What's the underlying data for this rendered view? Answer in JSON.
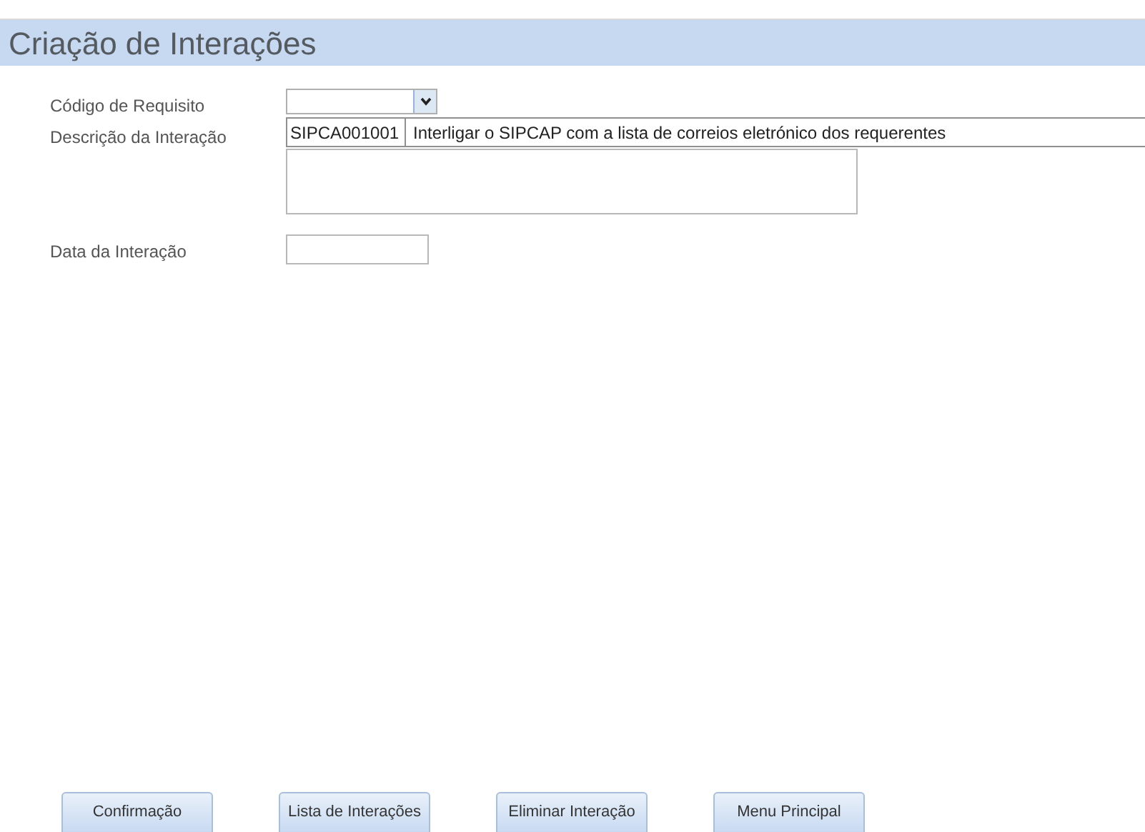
{
  "window": {
    "title": "Criação de Interações"
  },
  "fields": [
    {
      "label": "Código de Requisito",
      "kind": "combo"
    },
    {
      "label": "Descrição da Interação",
      "kind": "textarea"
    },
    {
      "label": "Data da Interação",
      "kind": "text"
    }
  ],
  "dropdown_list": {
    "rows": [
      {
        "code": "SIPCA001001",
        "description": "Interligar o SIPCAP com a lista de correios eletrónico dos requerentes"
      }
    ]
  },
  "buttons": [
    "Confirmação",
    "Lista de Interações",
    "Eliminar Interação",
    "Menu Principal"
  ]
}
